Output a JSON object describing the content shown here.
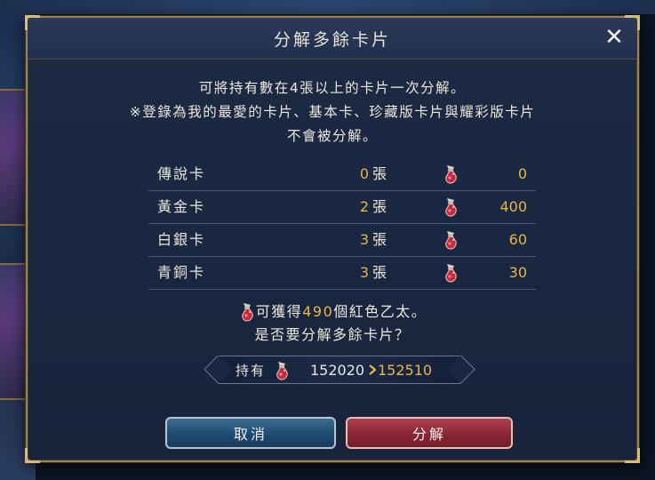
{
  "dialog": {
    "title": "分解多餘卡片",
    "close_label": "✕"
  },
  "description": {
    "line1": "可將持有數在4張以上的卡片一次分解。",
    "line2": "※登錄為我的最愛的卡片、基本卡、珍藏版卡片與耀彩版卡片",
    "line3": "不會被分解。"
  },
  "cards": [
    {
      "name": "傳說卡",
      "count": "0",
      "unit": "張",
      "amount": "0"
    },
    {
      "name": "黃金卡",
      "count": "2",
      "unit": "張",
      "amount": "400"
    },
    {
      "name": "白銀卡",
      "count": "3",
      "unit": "張",
      "amount": "60"
    },
    {
      "name": "青銅卡",
      "count": "3",
      "unit": "張",
      "amount": "30"
    }
  ],
  "result": {
    "prefix": "可獲得",
    "amount": "490",
    "suffix": "個紅色乙太。",
    "question": "是否要分解多餘卡片？"
  },
  "holding": {
    "label": "持有",
    "from": "152020",
    "to": "152510"
  },
  "buttons": {
    "cancel": "取消",
    "confirm": "分解"
  },
  "colors": {
    "highlight": "#e9b54a",
    "text": "#ece8dc",
    "ether": "#c42a3a"
  }
}
